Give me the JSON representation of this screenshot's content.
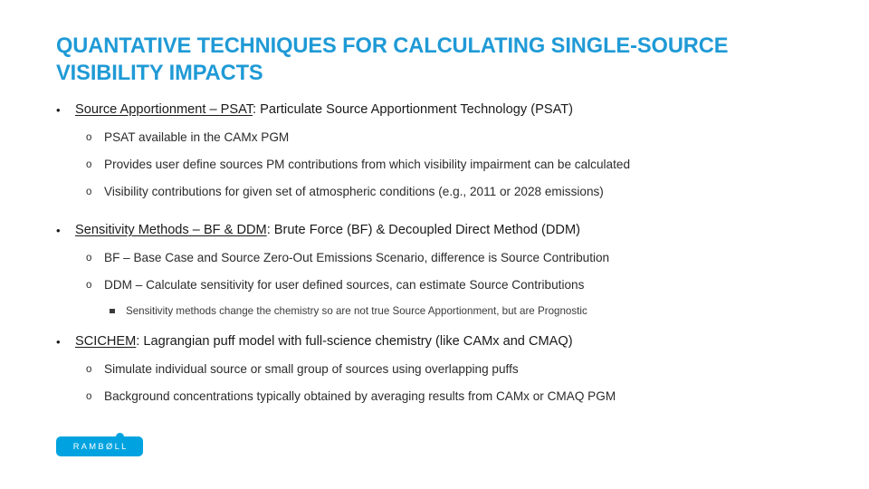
{
  "slide": {
    "title": "QUANTATIVE TECHNIQUES FOR CALCULATING SINGLE-SOURCE VISIBILITY IMPACTS",
    "title_color": "#1f9ad6",
    "background_color": "#ffffff",
    "body_text_color": "#1a1a1a"
  },
  "bullets": {
    "b1": {
      "marker": "•",
      "lead": "Source Apportionment – PSAT",
      "rest": ": Particulate Source Apportionment Technology (PSAT)"
    },
    "b1s1": {
      "marker": "o",
      "text": "PSAT available in the CAMx PGM"
    },
    "b1s2": {
      "marker": "o",
      "text": "Provides user define sources PM contributions from which visibility impairment can be calculated"
    },
    "b1s3": {
      "marker": "o",
      "text": "Visibility contributions for given set of atmospheric conditions (e.g., 2011 or 2028 emissions)"
    },
    "b2": {
      "marker": "•",
      "lead": "Sensitivity Methods – BF & DDM",
      "rest": ": Brute Force (BF) & Decoupled Direct Method (DDM)"
    },
    "b2s1": {
      "marker": "o",
      "text": "BF – Base Case and Source Zero-Out Emissions Scenario, difference is Source Contribution"
    },
    "b2s2": {
      "marker": "o",
      "text": "DDM – Calculate sensitivity for user defined sources, can estimate Source Contributions"
    },
    "b2s2a": {
      "marker": "▪",
      "text": "Sensitivity methods change the chemistry so are not true Source Apportionment, but are Prognostic"
    },
    "b3": {
      "marker": "•",
      "lead": "SCICHEM",
      "rest": ":  Lagrangian puff model with full-science chemistry (like CAMx and CMAQ)"
    },
    "b3s1": {
      "marker": "o",
      "text": "Simulate individual source or small group of sources using overlapping puffs"
    },
    "b3s2": {
      "marker": "o",
      "text": "Background concentrations typically obtained by averaging results from CAMx or CMAQ PGM"
    }
  },
  "logo": {
    "text": "RAMBØLL",
    "color": "#00a3e0",
    "text_color": "#ffffff"
  }
}
